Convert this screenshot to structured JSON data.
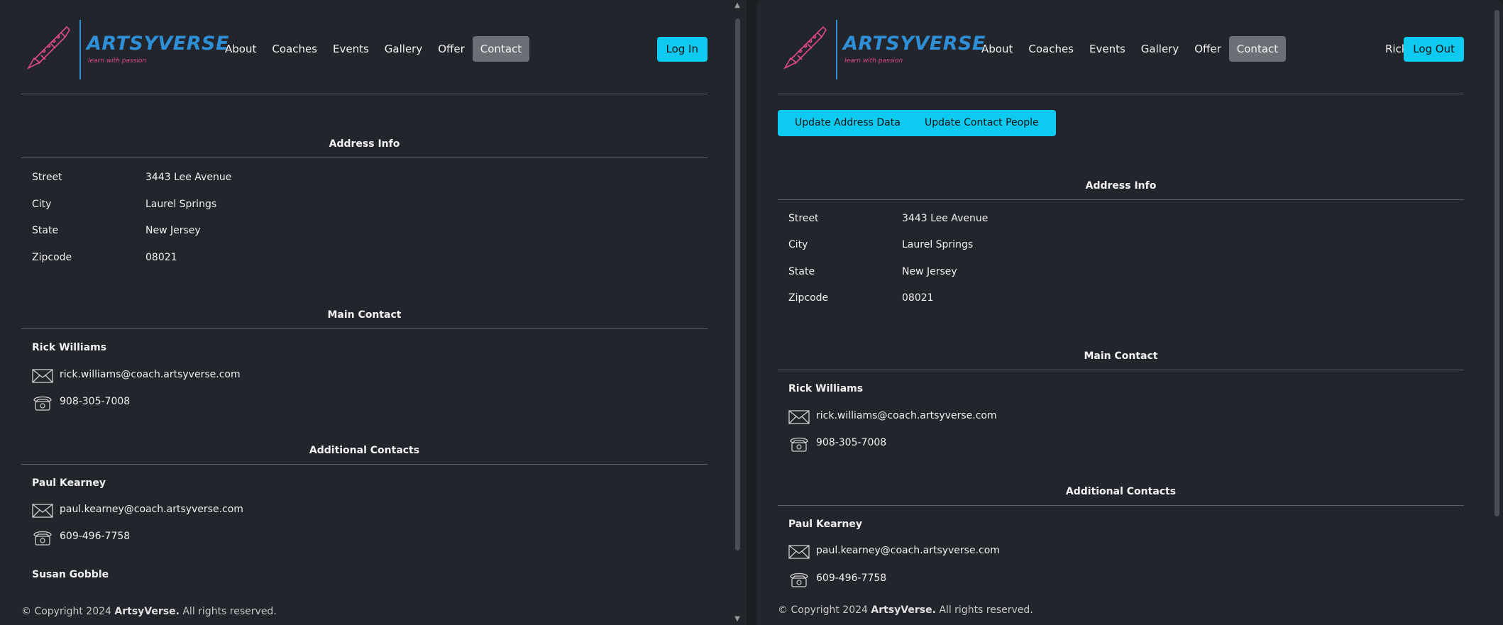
{
  "brand": {
    "name": "ARTSYVERSE",
    "tagline": "learn with passion"
  },
  "nav": {
    "items": [
      "About",
      "Coaches",
      "Events",
      "Gallery",
      "Offer",
      "Contact"
    ],
    "active": "Contact"
  },
  "left": {
    "login_label": "Log In"
  },
  "right": {
    "user_name": "Rick",
    "logout_label": "Log Out",
    "update_address_label": "Update Address Data",
    "update_contacts_label": "Update Contact People"
  },
  "address": {
    "title": "Address Info",
    "rows": [
      {
        "label": "Street",
        "value": "3443 Lee Avenue"
      },
      {
        "label": "City",
        "value": "Laurel Springs"
      },
      {
        "label": "State",
        "value": "New Jersey"
      },
      {
        "label": "Zipcode",
        "value": "08021"
      }
    ]
  },
  "main_contact": {
    "title": "Main Contact",
    "name": "Rick Williams",
    "email": "rick.williams@coach.artsyverse.com",
    "phone": "908-305-7008"
  },
  "additional_contacts": {
    "title": "Additional Contacts",
    "people": [
      {
        "name": "Paul Kearney",
        "email": "paul.kearney@coach.artsyverse.com",
        "phone": "609-496-7758"
      },
      {
        "name": "Susan Gobble"
      }
    ]
  },
  "footer": {
    "prefix": "© Copyright 2024",
    "brand": "ArtsyVerse.",
    "suffix": "All rights reserved."
  },
  "colors": {
    "accent": "#0dcaf0",
    "background": "#22252b",
    "nav_active": "#6b6f76",
    "logo_blue": "#2f8fd6",
    "logo_pink": "#e04b8a"
  },
  "icons": [
    "clarinet-logo-icon",
    "envelope-icon",
    "telephone-icon",
    "scroll-up-arrow-icon",
    "scroll-down-arrow-icon"
  ]
}
